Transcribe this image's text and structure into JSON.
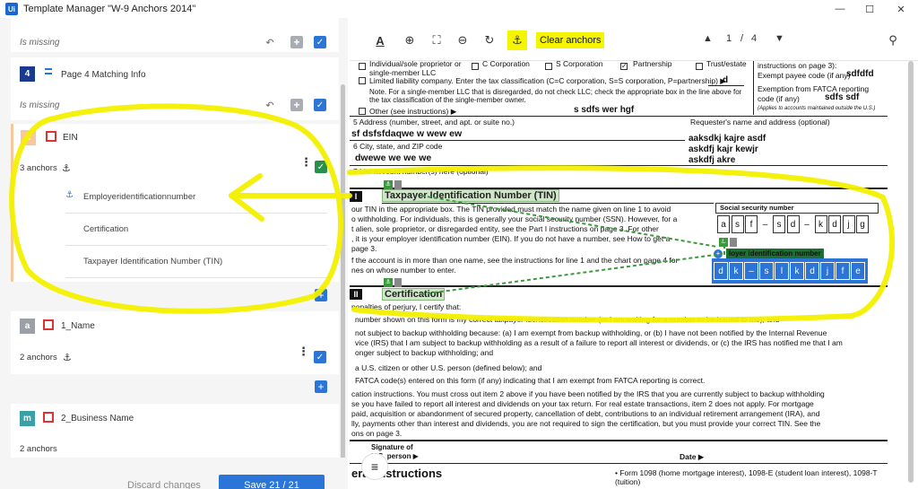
{
  "window": {
    "logo": "Ui",
    "title": "Template Manager \"W-9 Anchors 2014\"",
    "minimize": "—",
    "maximize": "☐",
    "close": "✕"
  },
  "left_panel": {
    "top_missing": "Is missing",
    "field4": {
      "number": "4",
      "title": "Page 4 Matching Info",
      "missing": "Is missing",
      "badge_color": "#1a3a8f"
    },
    "ein": {
      "badge": "e",
      "badge_color": "#f7c99a",
      "title": "EIN",
      "anchors_count": "3 anchors",
      "anchors": [
        "Employeridentificationnumber",
        "Certification",
        "Taxpayer Identification Number (TIN)"
      ]
    },
    "name": {
      "badge": "a",
      "badge_color": "#9aa0a6",
      "title": "1_Name",
      "anchors_count": "2 anchors"
    },
    "business": {
      "badge": "m",
      "badge_color": "#3aa0a8",
      "title": "2_Business Name",
      "anchors_count": "2 anchors"
    },
    "discard_label": "Discard changes",
    "save_label": "Save 21 / 21"
  },
  "toolbar": {
    "clear_anchors": "Clear anchors",
    "page_current": "1",
    "page_sep": "/",
    "page_total": "4"
  },
  "doc": {
    "cb_individual": "Individual/sole proprietor or",
    "cb_individual2": "single-member LLC",
    "cb_ccorp": "C Corporation",
    "cb_scorp": "S Corporation",
    "cb_partnership": "Partnership",
    "cb_trust": "Trust/estate",
    "llc_line": "Limited liability company. Enter the tax classification (C=C corporation, S=S corporation, P=partnership) ▶",
    "llc_value": "d",
    "note1": "Note. For a single-member LLC that is disregarded, do not check LLC; check the appropriate box in the line above for",
    "note2": "the tax classification of the single-member owner.",
    "other_line": "Other (see instructions) ▶",
    "other_value": "s sdfs wer hgf",
    "right_inst": "instructions on page 3):",
    "payee_code": "Exempt payee code (if any)",
    "payee_value": "sdfdfd",
    "fatca1": "Exemption from FATCA reporting",
    "fatca2": "code (if any)",
    "fatca_value": "sdfs sdf",
    "fatca_note": "(Applies to accounts maintained outside the U.S.)",
    "addr_label": "5  Address (number, street, and apt. or suite no.)",
    "addr_value": "sf dsfsfdaqwe w  wew ew",
    "req_label": "Requester's name and address (optional)",
    "req1": "aaksdkj kajre asdf",
    "req2": "askdfj kajr kewjr",
    "req3": "askdfj akre",
    "city_label": "6  City, state, and ZIP code",
    "city_value": "dwewe we we we",
    "acct_label": "7  List account number(s) here (optional)",
    "part1": "I",
    "tin_title": "Taxpayer Identification Number (TIN)",
    "tin_p1": "our TIN in the appropriate box. The TIN provided must match the name given on line 1 to avoid",
    "tin_p2": "o withholding. For individuals, this is generally your social security number (SSN). However, for a",
    "tin_p3": "t alien, sole proprietor, or disregarded entity, see the Part I instructions on page 3. For other",
    "tin_p4": ", it is your employer identification number (EIN). If you do not have a number, see How to get a",
    "tin_p5": "page 3.",
    "tin_p6": "f the account is in more than one name, see the instructions for line 1 and the chart on page 4 for",
    "tin_p7": "nes on whose number to enter.",
    "ssn_label": "Social security number",
    "ssn_cells": [
      "a",
      "s",
      "f",
      "–",
      "s",
      "d",
      "–",
      "k",
      "d",
      "j",
      "g"
    ],
    "ein_label": "loyer identification number",
    "ein_cells": [
      "d",
      "k",
      "–",
      "s",
      "l",
      "k",
      "d",
      "j",
      "f",
      "e"
    ],
    "part2": "II",
    "cert_title": "Certification",
    "cert1": "penalties of perjury, I certify that:",
    "cert2": "number shown on this form is my correct taxpayer identification number (or I am waiting for a number to be issued to me); and",
    "cert3": "not subject to backup withholding because: (a) I am exempt from backup withholding, or (b) I have not been notified by the Internal Revenue",
    "cert4": "vice (IRS) that I am subject to backup withholding as a result of a failure to report all interest or dividends, or (c) the IRS has notified me that I am",
    "cert5": "onger subject to backup withholding; and",
    "cert6": "a U.S. citizen or other U.S. person (defined below); and",
    "cert7": "FATCA code(s) entered on this form (if any) indicating that I am exempt from FATCA reporting is correct.",
    "ci1": "cation instructions. You must cross out item 2 above if you have been notified by the IRS that you are currently subject to backup withholding",
    "ci1b": "cation instructions.",
    "ci2": "se you have failed to report all interest and dividends on your tax return. For real estate transactions, item 2 does not apply. For mortgage",
    "ci3": "paid, acquisition or abandonment of secured property, cancellation of debt, contributions to an individual retirement arrangement (IRA), and",
    "ci4": "lly, payments other than interest and dividends, you are not required to sign the certification, but you must provide your correct TIN. See the",
    "ci5": "ons on page 3.",
    "sig_label": "Signature of",
    "sig_label2": "U.S. person ▶",
    "date_label": "Date ▶",
    "gen_title": "eral Instructions",
    "form1098": "• Form 1098 (home mortgage interest), 1098-E (student loan interest), 1098-T",
    "form1098b": "(tuition)"
  },
  "colors": {
    "accent": "#2b74d8",
    "highlight": "#f6f500",
    "green": "#2a8f4b"
  }
}
